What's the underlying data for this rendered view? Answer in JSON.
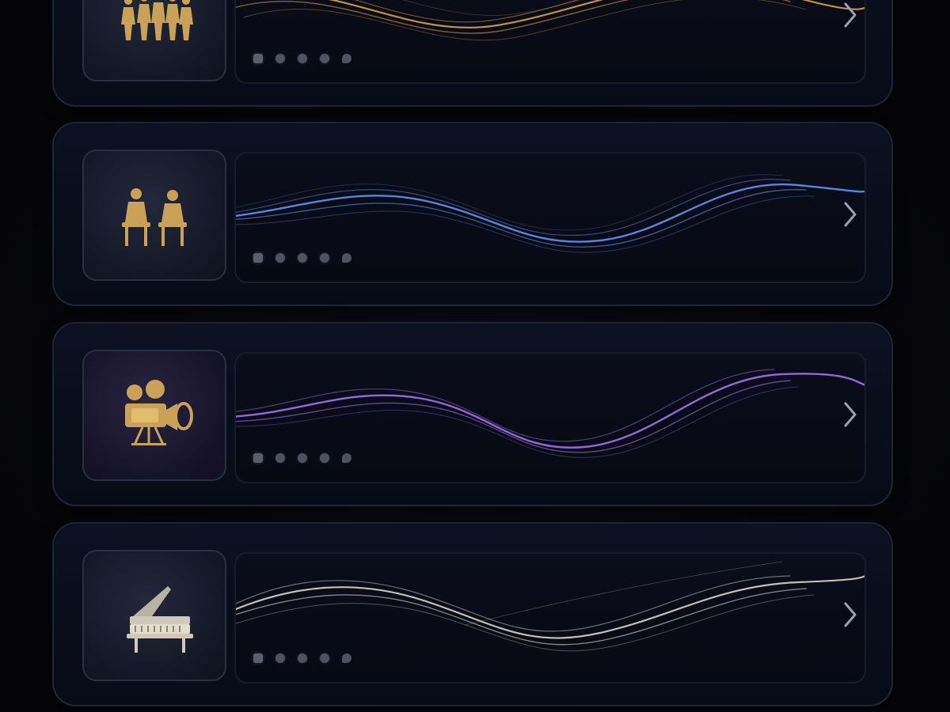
{
  "cards": [
    {
      "id": "orchestra",
      "icon": "orchestra-figures-icon",
      "accent": "#d4a14a",
      "controls": [
        "square",
        "dot",
        "dot",
        "dot",
        "dot"
      ]
    },
    {
      "id": "chamber",
      "icon": "seated-musicians-icon",
      "accent": "#5b8de6",
      "controls": [
        "square",
        "dot",
        "dot",
        "dot",
        "dot"
      ]
    },
    {
      "id": "film",
      "icon": "film-camera-icon",
      "accent": "#9a6ee0",
      "controls": [
        "square",
        "dot",
        "dot",
        "dot",
        "dot"
      ]
    },
    {
      "id": "piano",
      "icon": "grand-piano-icon",
      "accent": "#d8d2c6",
      "controls": [
        "square",
        "dot",
        "dot",
        "dot",
        "dot"
      ]
    }
  ],
  "colors": {
    "background": "#050508",
    "card": "#0a0e1c",
    "card_border": "#1f2536",
    "gold_icon": "#c9a257",
    "chevron": "#9aa0ae"
  }
}
